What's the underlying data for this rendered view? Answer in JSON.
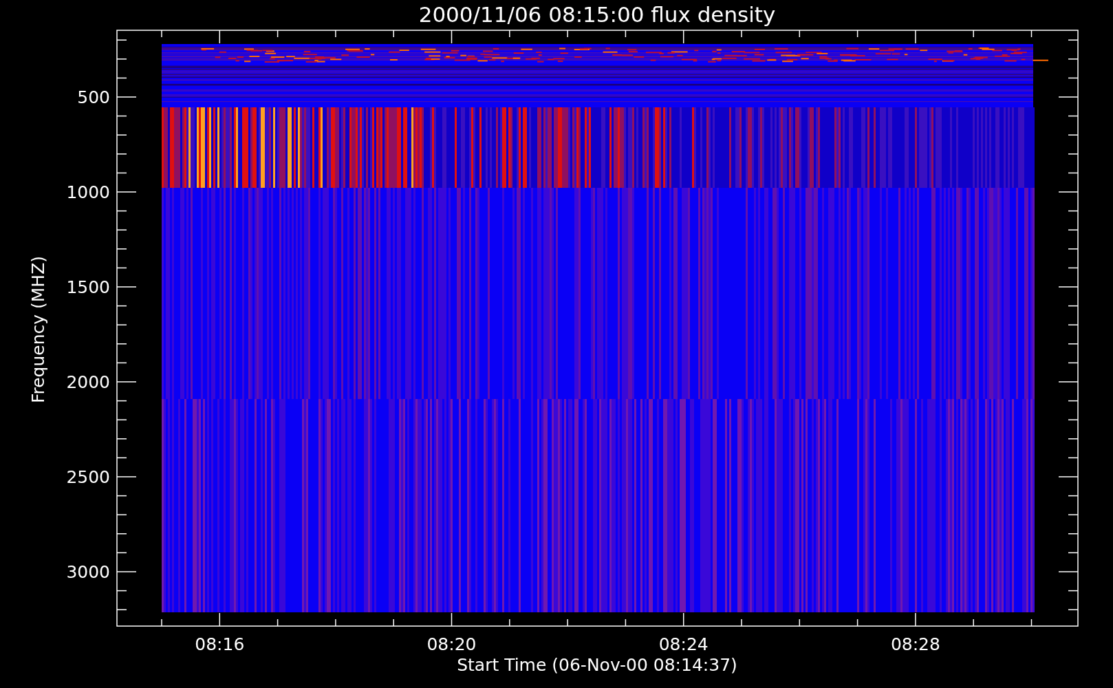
{
  "plot": {
    "title": "2000/11/06 08:15:00 flux density",
    "y_axis": {
      "label": "Frequency (MHZ)",
      "tick_labels": [
        "500",
        "1000",
        "1500",
        "2000",
        "2500",
        "3000"
      ]
    },
    "x_axis": {
      "label": "Start Time (06-Nov-00 08:14:37)",
      "tick_labels": [
        "08:16",
        "08:20",
        "08:24",
        "08:28"
      ]
    }
  }
}
